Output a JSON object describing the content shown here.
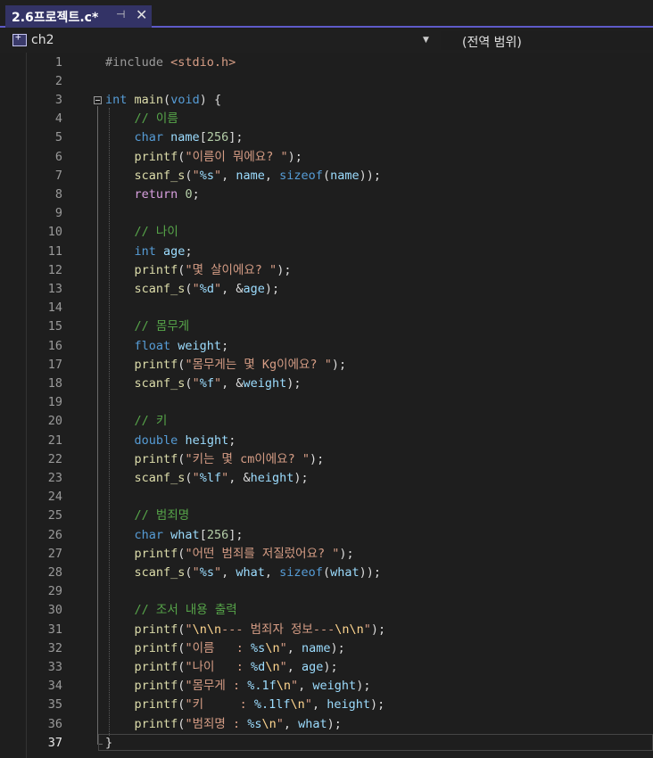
{
  "tab": {
    "title": "2.6프로젝트.c*",
    "pin_glyph": "⊣",
    "close_glyph": "✕"
  },
  "nav": {
    "project": "ch2",
    "scope": "(전역 범위)"
  },
  "editor": {
    "current_line": 37,
    "lines": [
      [
        [
          "pp",
          "#include "
        ],
        [
          "inc",
          "<stdio.h>"
        ]
      ],
      [],
      [
        [
          "kw",
          "int"
        ],
        [
          "pl",
          " "
        ],
        [
          "fn",
          "main"
        ],
        [
          "pl",
          "("
        ],
        [
          "kw",
          "void"
        ],
        [
          "pl",
          ") {"
        ]
      ],
      [
        [
          "pl",
          "    "
        ],
        [
          "cmt",
          "// 이름"
        ]
      ],
      [
        [
          "pl",
          "    "
        ],
        [
          "kw",
          "char"
        ],
        [
          "pl",
          " "
        ],
        [
          "var",
          "name"
        ],
        [
          "pl",
          "["
        ],
        [
          "num",
          "256"
        ],
        [
          "pl",
          "];"
        ]
      ],
      [
        [
          "pl",
          "    "
        ],
        [
          "fn",
          "printf"
        ],
        [
          "pl",
          "("
        ],
        [
          "str",
          "\"이름이 뭐에요? \""
        ],
        [
          "pl",
          ");"
        ]
      ],
      [
        [
          "pl",
          "    "
        ],
        [
          "fn",
          "scanf_s"
        ],
        [
          "pl",
          "("
        ],
        [
          "str",
          "\""
        ],
        [
          "fmt",
          "%s"
        ],
        [
          "str",
          "\""
        ],
        [
          "pl",
          ", "
        ],
        [
          "var",
          "name"
        ],
        [
          "pl",
          ", "
        ],
        [
          "kw",
          "sizeof"
        ],
        [
          "pl",
          "("
        ],
        [
          "var",
          "name"
        ],
        [
          "pl",
          "));"
        ]
      ],
      [
        [
          "pl",
          "    "
        ],
        [
          "ctl",
          "return"
        ],
        [
          "pl",
          " "
        ],
        [
          "num",
          "0"
        ],
        [
          "pl",
          ";"
        ]
      ],
      [],
      [
        [
          "pl",
          "    "
        ],
        [
          "cmt",
          "// 나이"
        ]
      ],
      [
        [
          "pl",
          "    "
        ],
        [
          "kw",
          "int"
        ],
        [
          "pl",
          " "
        ],
        [
          "var",
          "age"
        ],
        [
          "pl",
          ";"
        ]
      ],
      [
        [
          "pl",
          "    "
        ],
        [
          "fn",
          "printf"
        ],
        [
          "pl",
          "("
        ],
        [
          "str",
          "\"몇 살이에요? \""
        ],
        [
          "pl",
          ");"
        ]
      ],
      [
        [
          "pl",
          "    "
        ],
        [
          "fn",
          "scanf_s"
        ],
        [
          "pl",
          "("
        ],
        [
          "str",
          "\""
        ],
        [
          "fmt",
          "%d"
        ],
        [
          "str",
          "\""
        ],
        [
          "pl",
          ", &"
        ],
        [
          "var",
          "age"
        ],
        [
          "pl",
          ");"
        ]
      ],
      [],
      [
        [
          "pl",
          "    "
        ],
        [
          "cmt",
          "// 몸무게"
        ]
      ],
      [
        [
          "pl",
          "    "
        ],
        [
          "kw",
          "float"
        ],
        [
          "pl",
          " "
        ],
        [
          "var",
          "weight"
        ],
        [
          "pl",
          ";"
        ]
      ],
      [
        [
          "pl",
          "    "
        ],
        [
          "fn",
          "printf"
        ],
        [
          "pl",
          "("
        ],
        [
          "str",
          "\"몸무게는 몇 Kg이에요? \""
        ],
        [
          "pl",
          ");"
        ]
      ],
      [
        [
          "pl",
          "    "
        ],
        [
          "fn",
          "scanf_s"
        ],
        [
          "pl",
          "("
        ],
        [
          "str",
          "\""
        ],
        [
          "fmt",
          "%f"
        ],
        [
          "str",
          "\""
        ],
        [
          "pl",
          ", &"
        ],
        [
          "var",
          "weight"
        ],
        [
          "pl",
          ");"
        ]
      ],
      [],
      [
        [
          "pl",
          "    "
        ],
        [
          "cmt",
          "// 키"
        ]
      ],
      [
        [
          "pl",
          "    "
        ],
        [
          "kw",
          "double"
        ],
        [
          "pl",
          " "
        ],
        [
          "var",
          "height"
        ],
        [
          "pl",
          ";"
        ]
      ],
      [
        [
          "pl",
          "    "
        ],
        [
          "fn",
          "printf"
        ],
        [
          "pl",
          "("
        ],
        [
          "str",
          "\"키는 몇 cm이에요? \""
        ],
        [
          "pl",
          ");"
        ]
      ],
      [
        [
          "pl",
          "    "
        ],
        [
          "fn",
          "scanf_s"
        ],
        [
          "pl",
          "("
        ],
        [
          "str",
          "\""
        ],
        [
          "fmt",
          "%lf"
        ],
        [
          "str",
          "\""
        ],
        [
          "pl",
          ", &"
        ],
        [
          "var",
          "height"
        ],
        [
          "pl",
          ");"
        ]
      ],
      [],
      [
        [
          "pl",
          "    "
        ],
        [
          "cmt",
          "// 범죄명"
        ]
      ],
      [
        [
          "pl",
          "    "
        ],
        [
          "kw",
          "char"
        ],
        [
          "pl",
          " "
        ],
        [
          "var",
          "what"
        ],
        [
          "pl",
          "["
        ],
        [
          "num",
          "256"
        ],
        [
          "pl",
          "];"
        ]
      ],
      [
        [
          "pl",
          "    "
        ],
        [
          "fn",
          "printf"
        ],
        [
          "pl",
          "("
        ],
        [
          "str",
          "\"어떤 범죄를 저질렀어요? \""
        ],
        [
          "pl",
          ");"
        ]
      ],
      [
        [
          "pl",
          "    "
        ],
        [
          "fn",
          "scanf_s"
        ],
        [
          "pl",
          "("
        ],
        [
          "str",
          "\""
        ],
        [
          "fmt",
          "%s"
        ],
        [
          "str",
          "\""
        ],
        [
          "pl",
          ", "
        ],
        [
          "var",
          "what"
        ],
        [
          "pl",
          ", "
        ],
        [
          "kw",
          "sizeof"
        ],
        [
          "pl",
          "("
        ],
        [
          "var",
          "what"
        ],
        [
          "pl",
          "));"
        ]
      ],
      [],
      [
        [
          "pl",
          "    "
        ],
        [
          "cmt",
          "// 조서 내용 출력"
        ]
      ],
      [
        [
          "pl",
          "    "
        ],
        [
          "fn",
          "printf"
        ],
        [
          "pl",
          "("
        ],
        [
          "str",
          "\""
        ],
        [
          "esc",
          "\\n\\n"
        ],
        [
          "str",
          "--- 범죄자 정보---"
        ],
        [
          "esc",
          "\\n\\n"
        ],
        [
          "str",
          "\""
        ],
        [
          "pl",
          ");"
        ]
      ],
      [
        [
          "pl",
          "    "
        ],
        [
          "fn",
          "printf"
        ],
        [
          "pl",
          "("
        ],
        [
          "str",
          "\"이름   : "
        ],
        [
          "fmt",
          "%s"
        ],
        [
          "esc",
          "\\n"
        ],
        [
          "str",
          "\""
        ],
        [
          "pl",
          ", "
        ],
        [
          "var",
          "name"
        ],
        [
          "pl",
          ");"
        ]
      ],
      [
        [
          "pl",
          "    "
        ],
        [
          "fn",
          "printf"
        ],
        [
          "pl",
          "("
        ],
        [
          "str",
          "\"나이   : "
        ],
        [
          "fmt",
          "%d"
        ],
        [
          "esc",
          "\\n"
        ],
        [
          "str",
          "\""
        ],
        [
          "pl",
          ", "
        ],
        [
          "var",
          "age"
        ],
        [
          "pl",
          ");"
        ]
      ],
      [
        [
          "pl",
          "    "
        ],
        [
          "fn",
          "printf"
        ],
        [
          "pl",
          "("
        ],
        [
          "str",
          "\"몸무게 : "
        ],
        [
          "fmt",
          "%.1f"
        ],
        [
          "esc",
          "\\n"
        ],
        [
          "str",
          "\""
        ],
        [
          "pl",
          ", "
        ],
        [
          "var",
          "weight"
        ],
        [
          "pl",
          ");"
        ]
      ],
      [
        [
          "pl",
          "    "
        ],
        [
          "fn",
          "printf"
        ],
        [
          "pl",
          "("
        ],
        [
          "str",
          "\"키     : "
        ],
        [
          "fmt",
          "%.1lf"
        ],
        [
          "esc",
          "\\n"
        ],
        [
          "str",
          "\""
        ],
        [
          "pl",
          ", "
        ],
        [
          "var",
          "height"
        ],
        [
          "pl",
          ");"
        ]
      ],
      [
        [
          "pl",
          "    "
        ],
        [
          "fn",
          "printf"
        ],
        [
          "pl",
          "("
        ],
        [
          "str",
          "\"범죄명 : "
        ],
        [
          "fmt",
          "%s"
        ],
        [
          "esc",
          "\\n"
        ],
        [
          "str",
          "\""
        ],
        [
          "pl",
          ", "
        ],
        [
          "var",
          "what"
        ],
        [
          "pl",
          ");"
        ]
      ],
      [
        [
          "pl",
          "}"
        ]
      ]
    ]
  }
}
